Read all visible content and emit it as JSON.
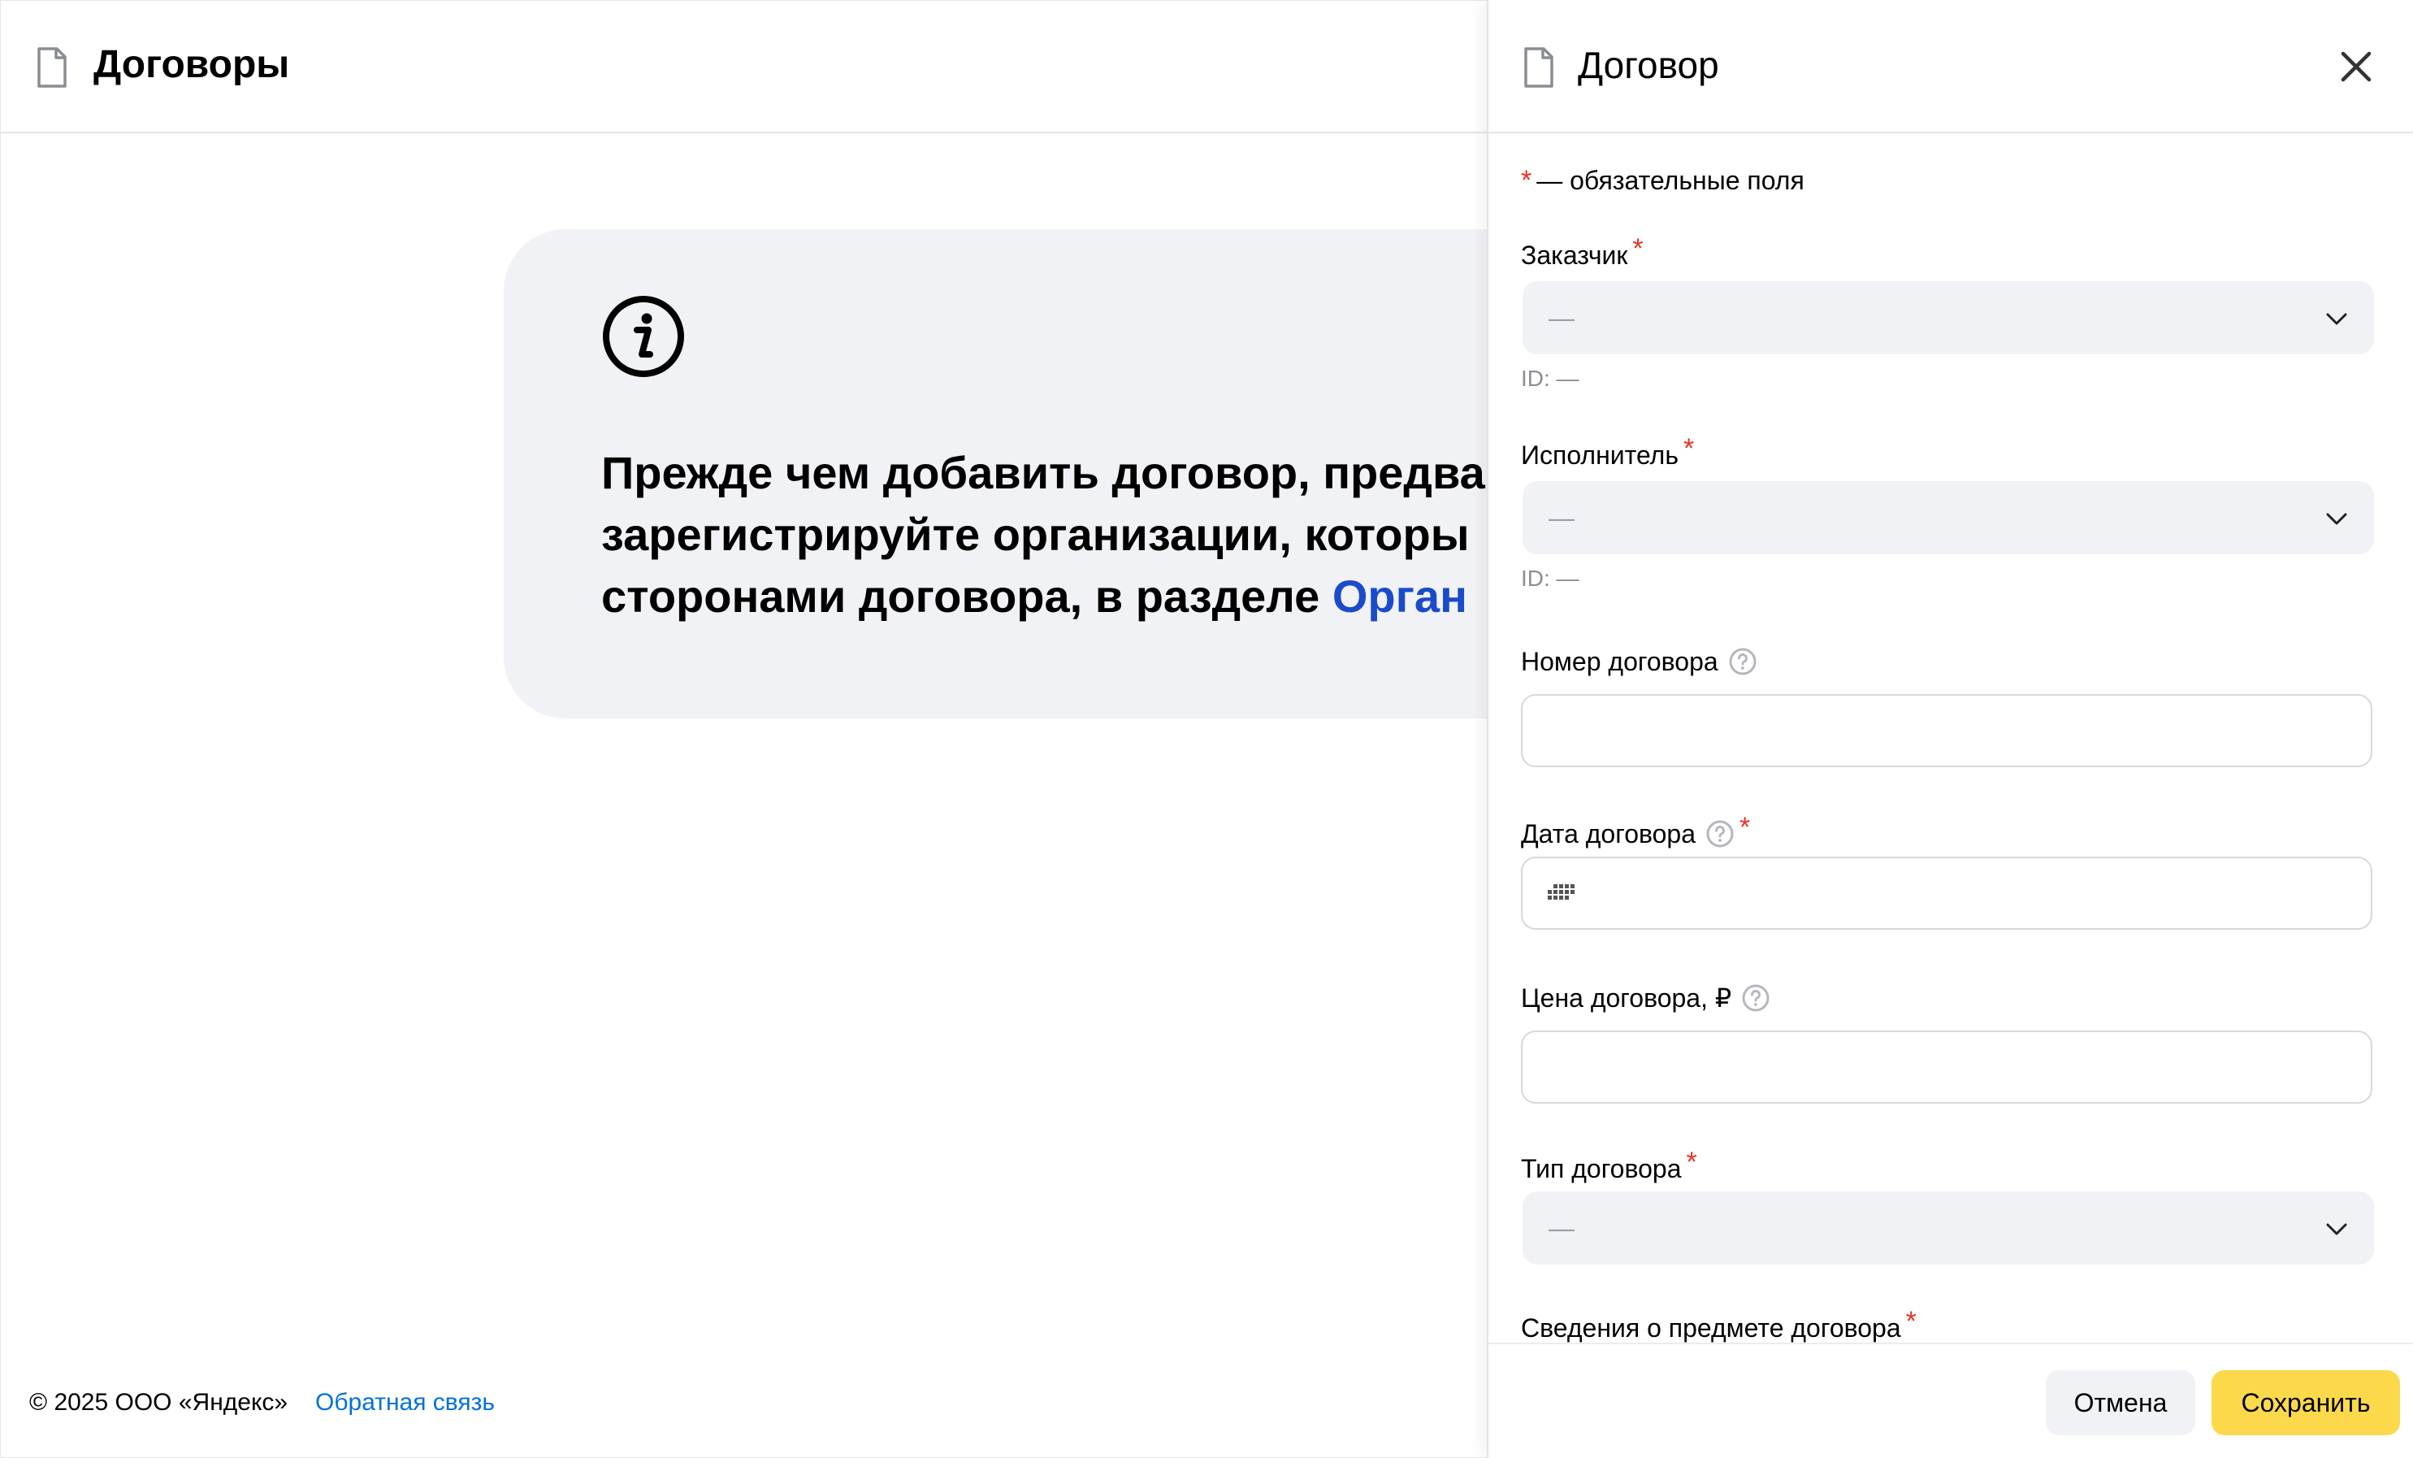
{
  "main": {
    "title": "Договоры",
    "info_lines": [
      "Прежде чем добавить договор, предва",
      "зарегистрируйте организации, которы",
      "сторонами договора, в разделе "
    ],
    "info_link": "Орган",
    "footer_copyright": "© 2025 ООО «Яндекс»",
    "footer_link": "Обратная связь"
  },
  "drawer": {
    "title": "Договор",
    "required_note": "— обязательные поля",
    "required_mark": "*",
    "customer": {
      "label": "Заказчик",
      "value": "—",
      "id": "ID: —"
    },
    "executor": {
      "label": "Исполнитель",
      "value": "—",
      "id": "ID: —"
    },
    "contract_number": {
      "label": "Номер договора",
      "value": ""
    },
    "contract_date": {
      "label": "Дата договора",
      "value": ""
    },
    "contract_price": {
      "label": "Цена договора, ₽",
      "value": ""
    },
    "contract_type": {
      "label": "Тип договора",
      "value": "—"
    },
    "subject_info": {
      "label": "Сведения о предмете договора"
    },
    "buttons": {
      "cancel": "Отмена",
      "save": "Сохранить"
    }
  },
  "colors": {
    "accent_yellow": "#fcd94a",
    "link_blue": "#1a4bcb",
    "required_red": "#e63224",
    "field_gray": "#f1f2f5"
  }
}
